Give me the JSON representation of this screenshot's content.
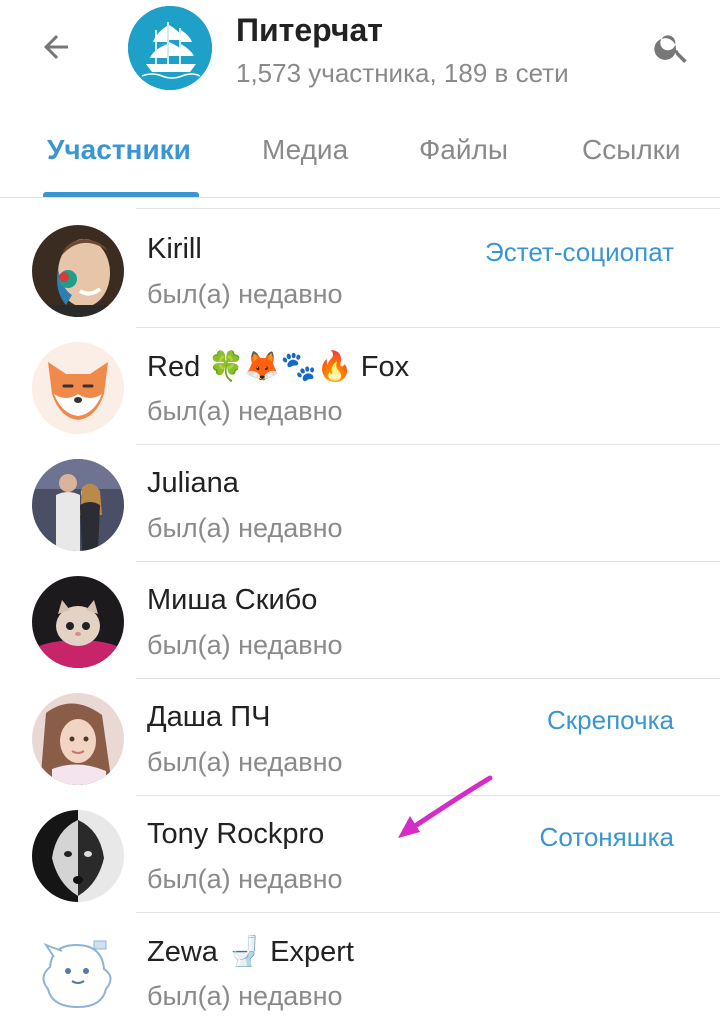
{
  "header": {
    "title": "Питерчат",
    "subtitle": "1,573 участника, 189 в сети",
    "back_icon": "arrow-back-icon",
    "search_icon": "search-icon",
    "avatar_icon": "sailing-ship-icon",
    "avatar_color": "#1ea0c9"
  },
  "tabs": [
    {
      "label": "Участники",
      "active": true
    },
    {
      "label": "Медиа",
      "active": false
    },
    {
      "label": "Файлы",
      "active": false
    },
    {
      "label": "Ссылки",
      "active": false
    }
  ],
  "accent": "#3a95d3",
  "members": [
    {
      "name": "Kirill",
      "status": "был(а) недавно",
      "role": "Эстет-социопат"
    },
    {
      "name": "Red 🍀🦊🐾🔥 Fox",
      "status": "был(а) недавно",
      "role": ""
    },
    {
      "name": "Juliana",
      "status": "был(а) недавно",
      "role": ""
    },
    {
      "name": "Миша Скибо",
      "status": "был(а) недавно",
      "role": ""
    },
    {
      "name": "Даша ПЧ",
      "status": "был(а) недавно",
      "role": "Скрепочка"
    },
    {
      "name": "Tony Rockpro",
      "status": "был(а) недавно",
      "role": "Сотоняшка"
    },
    {
      "name": "Zewa 🚽 Expert",
      "status": "был(а) недавно",
      "role": ""
    }
  ]
}
